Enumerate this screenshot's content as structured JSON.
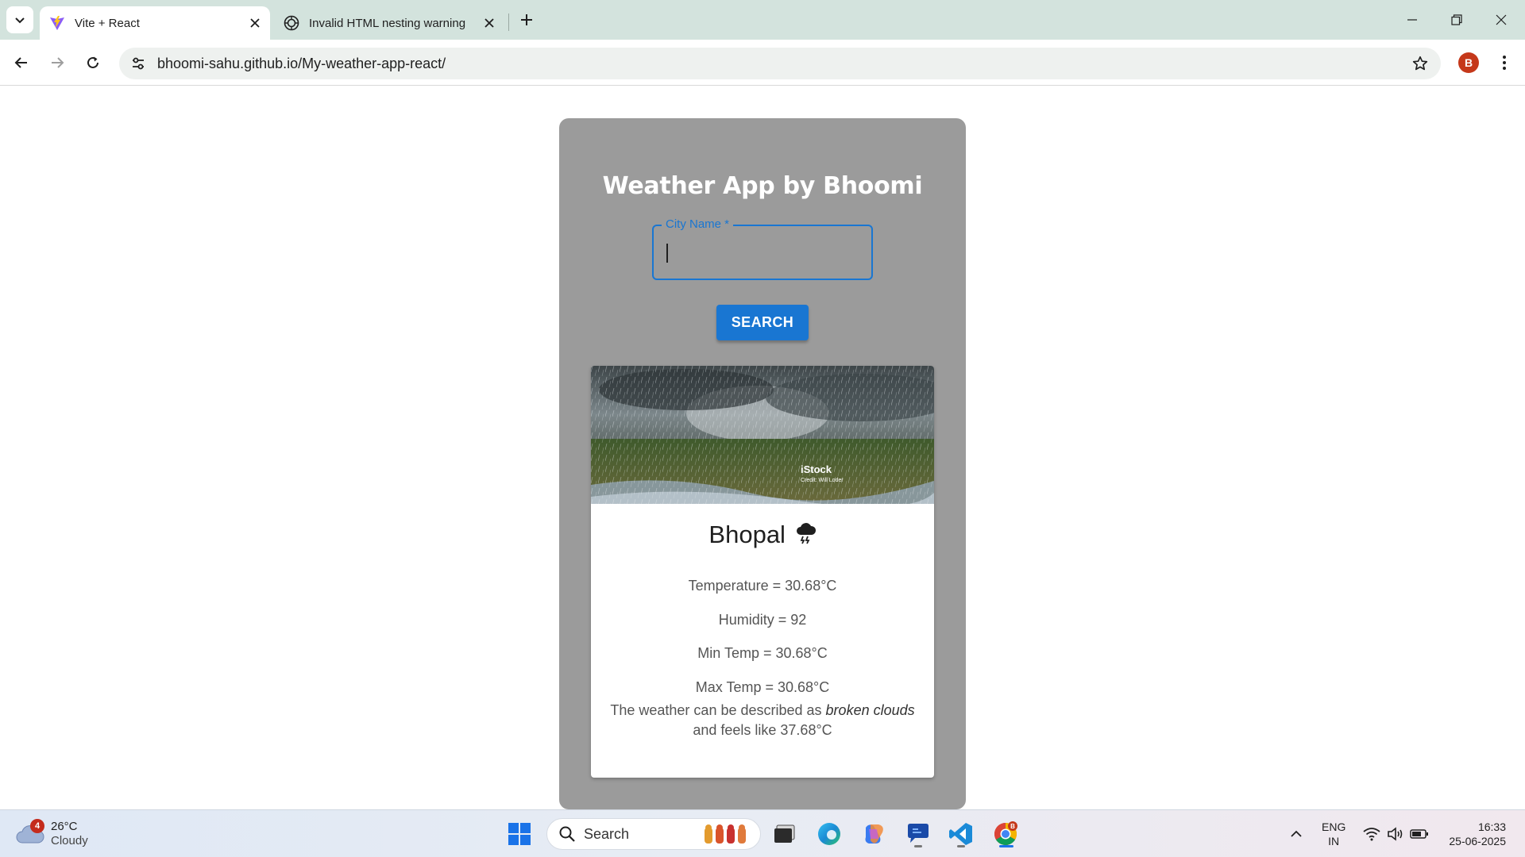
{
  "browser": {
    "tabs": [
      {
        "title": "Vite + React",
        "active": true,
        "favicon": "vite-icon"
      },
      {
        "title": "Invalid HTML nesting warning",
        "active": false,
        "favicon": "chatgpt-icon"
      }
    ],
    "url": "bhoomi-sahu.github.io/My-weather-app-react/",
    "profile_initial": "B"
  },
  "app": {
    "title": "Weather App by Bhoomi",
    "input_label": "City Name *",
    "input_value": "",
    "search_label": "SEARCH",
    "weather": {
      "city": "Bhopal",
      "condition_icon": "thunderstorm-icon",
      "temperature": "Temperature = 30.68°C",
      "humidity": "Humidity = 92",
      "min_temp": "Min Temp = 30.68°C",
      "max_temp": "Max Temp = 30.68°C",
      "desc_prefix": "The weather can be described as ",
      "desc_condition": "broken clouds",
      "desc_suffix": " and feels like 37.68°C",
      "image_watermark": "iStock",
      "image_credit": "Credit: Will Loder"
    }
  },
  "taskbar": {
    "weather": {
      "temp": "26°C",
      "condition": "Cloudy",
      "badge": "4"
    },
    "search_placeholder": "Search",
    "language": {
      "line1": "ENG",
      "line2": "IN"
    },
    "time": "16:33",
    "date": "25-06-2025"
  },
  "colors": {
    "accent": "#1976d2",
    "card_bg": "#9b9b9b",
    "tab_strip": "#d3e3dd"
  }
}
